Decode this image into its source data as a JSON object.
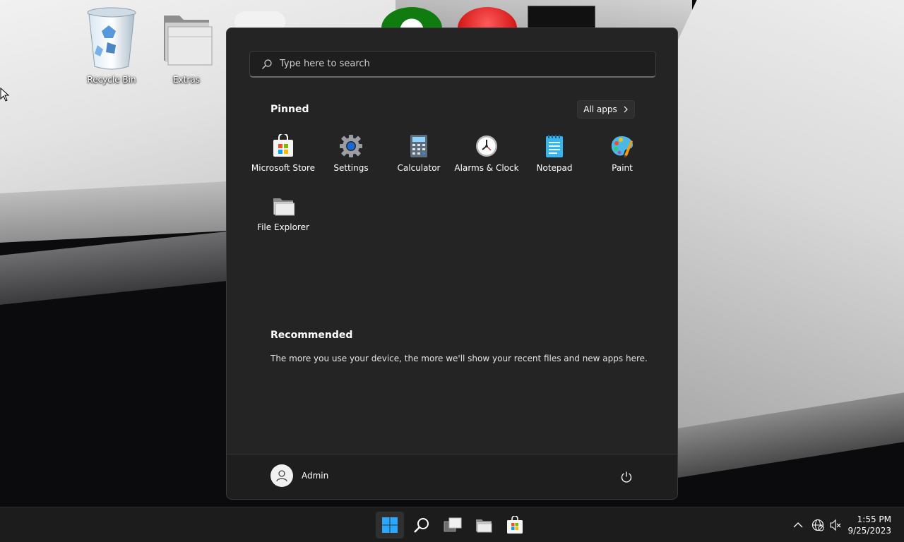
{
  "desktop": {
    "icons": [
      {
        "label": "Recycle Bin"
      },
      {
        "label": "Extras"
      }
    ]
  },
  "start_menu": {
    "search": {
      "placeholder": "Type here to search"
    },
    "pinned": {
      "title": "Pinned",
      "all_apps_label": "All apps",
      "apps": [
        {
          "label": "Microsoft Store",
          "icon": "store-icon"
        },
        {
          "label": "Settings",
          "icon": "gear-icon"
        },
        {
          "label": "Calculator",
          "icon": "calculator-icon"
        },
        {
          "label": "Alarms & Clock",
          "icon": "clock-icon"
        },
        {
          "label": "Notepad",
          "icon": "notepad-icon"
        },
        {
          "label": "Paint",
          "icon": "paint-icon"
        },
        {
          "label": "File Explorer",
          "icon": "folder-icon"
        }
      ]
    },
    "recommended": {
      "title": "Recommended",
      "message": "The more you use your device, the more we'll show your recent files and new apps here."
    },
    "user": {
      "name": "Admin"
    }
  },
  "taskbar": {
    "clock": {
      "time": "1:55 PM",
      "date": "9/25/2023"
    }
  },
  "colors": {
    "menu_bg": "#242424",
    "footer_bg": "#1e1e1e",
    "taskbar_bg": "#1c1c1c",
    "accent": "#0a84ff"
  }
}
